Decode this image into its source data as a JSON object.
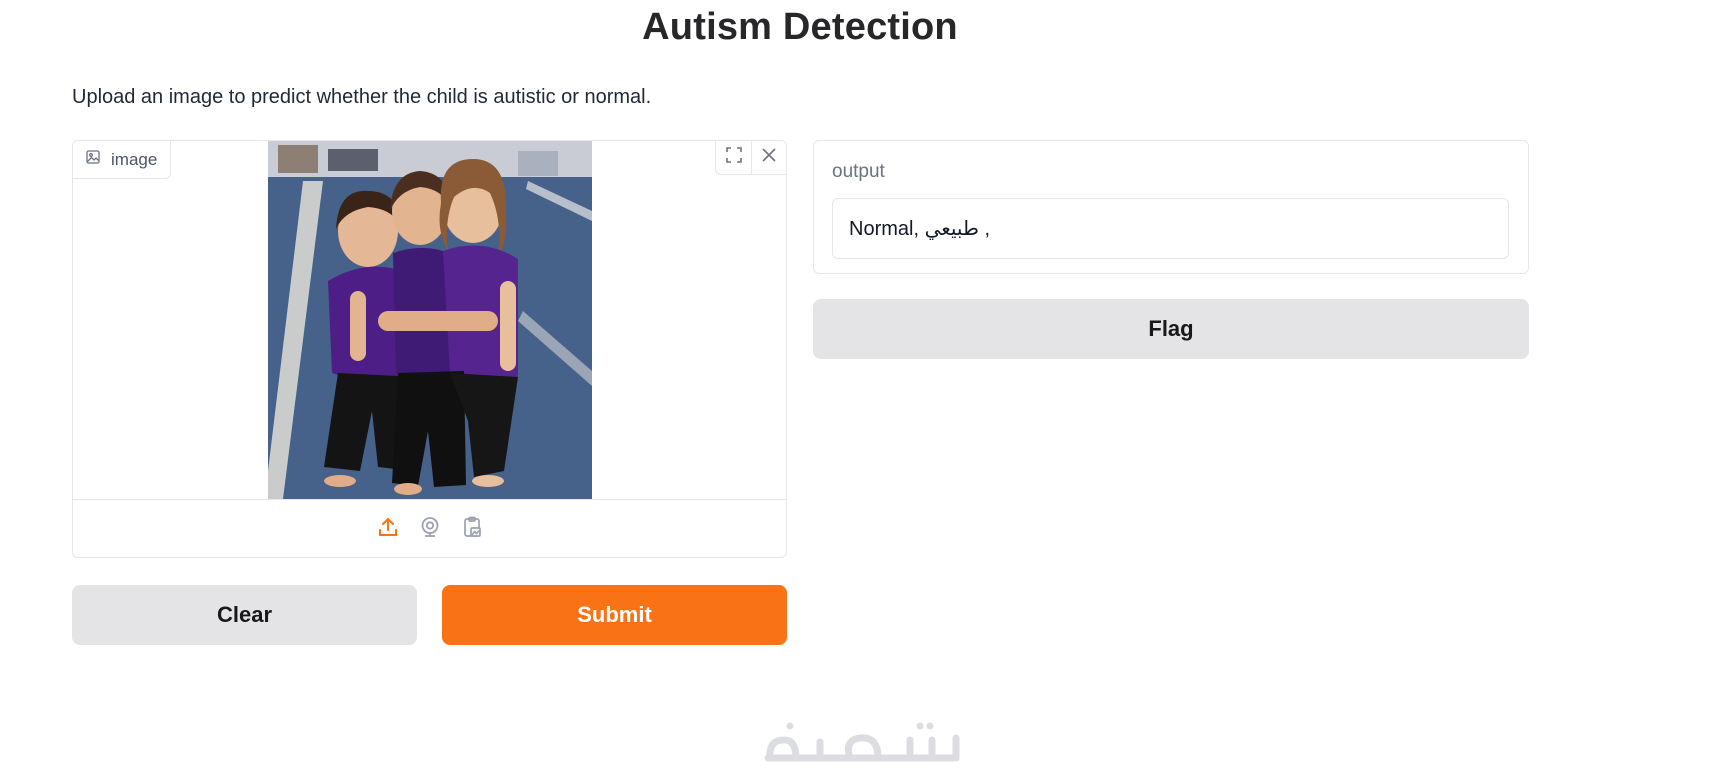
{
  "page": {
    "title": "Autism Detection",
    "description": "Upload an image to predict whether the child is autistic or normal."
  },
  "input": {
    "image_label": "image",
    "icons": [
      "image-icon",
      "fullscreen-icon",
      "close-icon",
      "upload-icon",
      "webcam-icon",
      "clipboard-icon"
    ]
  },
  "buttons": {
    "clear": "Clear",
    "submit": "Submit",
    "flag": "Flag"
  },
  "output": {
    "label": "output",
    "value": "Normal, طبيعي ,"
  },
  "watermark": {
    "text": "خمسات"
  },
  "colors": {
    "accent": "#f97316",
    "secondary_button": "#e4e4e7",
    "border": "#e5e7eb"
  }
}
